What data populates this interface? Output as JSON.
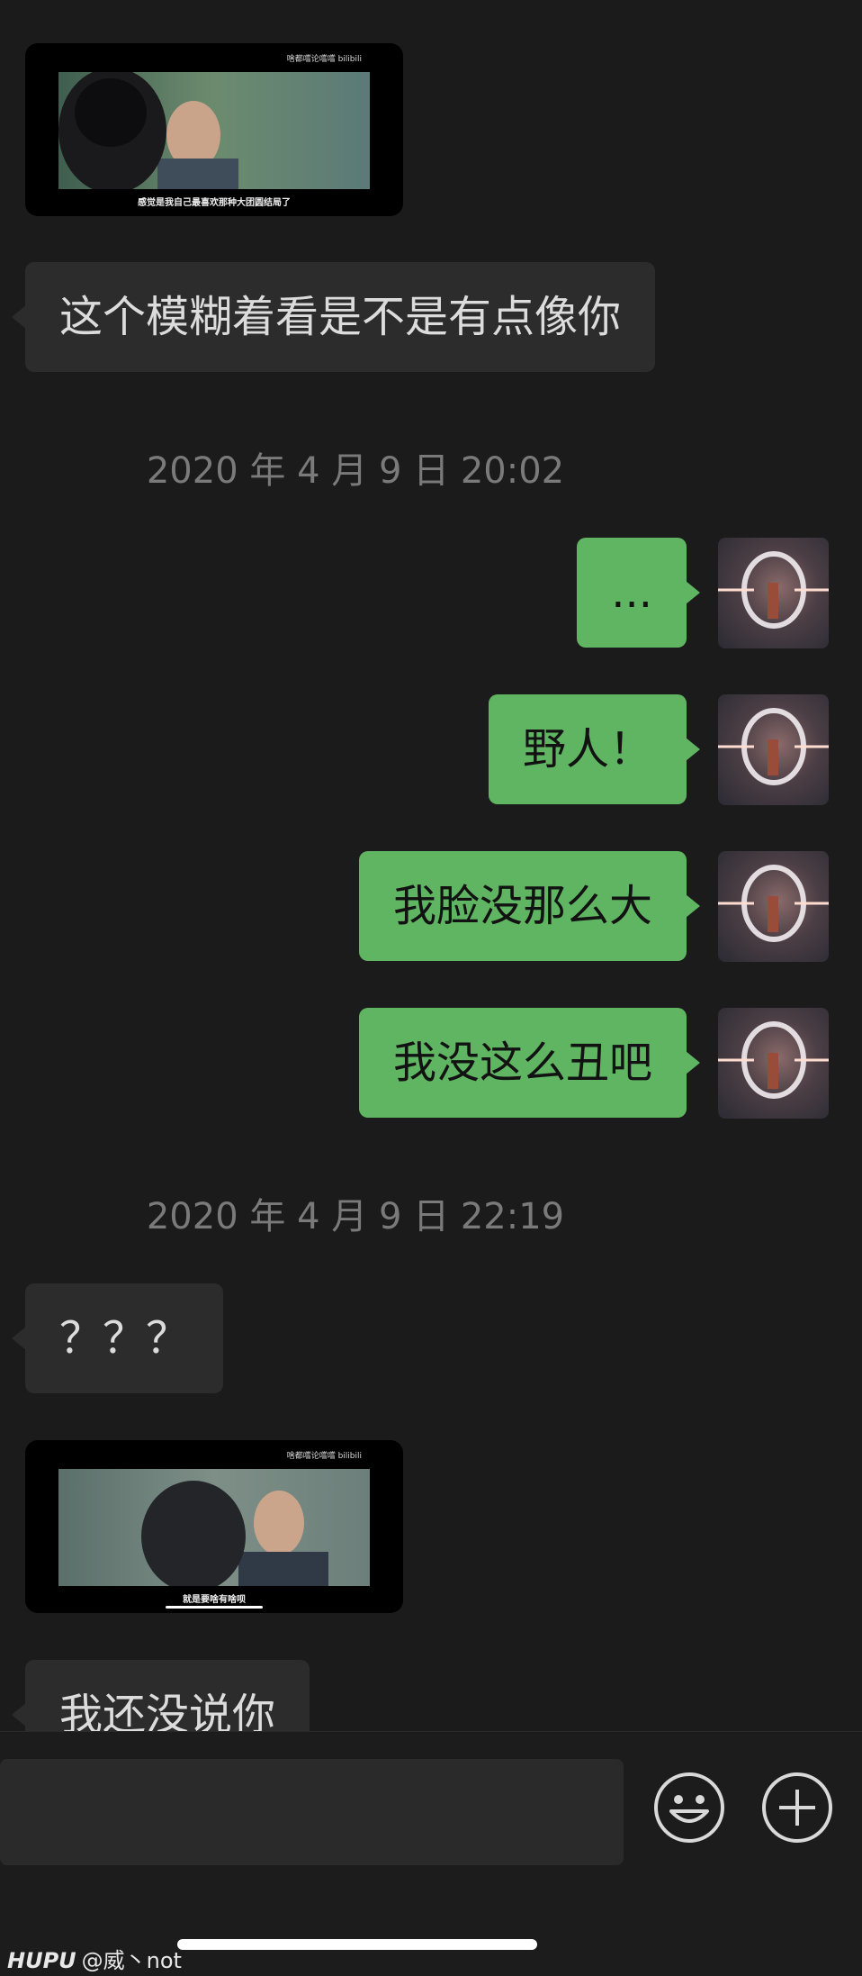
{
  "messages": [
    {
      "kind": "media_in",
      "brand": "啥都嚐论嚐嚐 bilibili",
      "subtitle": "感觉是我自己最喜欢那种大团圆结局了"
    },
    {
      "kind": "text_in",
      "text": "这个模糊着看是不是有点像你"
    },
    {
      "kind": "timestamp",
      "text": "2020 年 4 月 9 日 20:02"
    },
    {
      "kind": "text_out",
      "text": "..."
    },
    {
      "kind": "text_out",
      "text": "野人！"
    },
    {
      "kind": "text_out",
      "text": "我脸没那么大"
    },
    {
      "kind": "text_out",
      "text": "我没这么丑吧"
    },
    {
      "kind": "timestamp",
      "text": "2020 年 4 月 9 日 22:19"
    },
    {
      "kind": "text_in",
      "text": "？？？"
    },
    {
      "kind": "media_in",
      "brand": "啥都嚐论嚐嚐 bilibili",
      "subtitle": "就是要啥有啥呗"
    },
    {
      "kind": "text_in",
      "text": "我还没说你"
    }
  ],
  "input": {
    "value": ""
  },
  "watermark": {
    "logo": "HUPU",
    "handle": "@威丶not"
  },
  "colors": {
    "background": "#1b1b1b",
    "bubble_in": "#2c2c2c",
    "bubble_out": "#5fb562"
  }
}
